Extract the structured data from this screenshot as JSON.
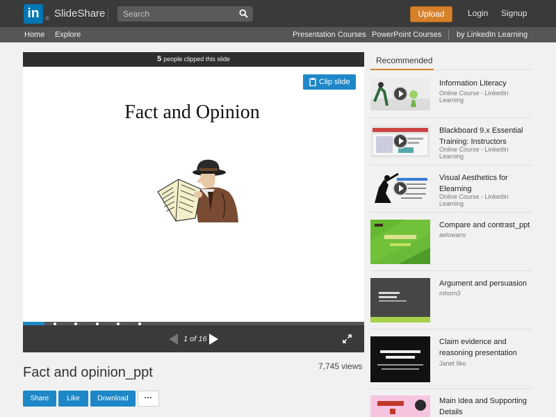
{
  "header": {
    "logo_text": "in",
    "registered_mark": "®",
    "brand": "SlideShare",
    "search_placeholder": "Search",
    "upload_label": "Upload",
    "login_label": "Login",
    "signup_label": "Signup"
  },
  "nav": {
    "left": [
      "Home",
      "Explore"
    ],
    "right": [
      "Presentation Courses",
      "PowerPoint Courses",
      "by LinkedIn Learning"
    ]
  },
  "slide_panel": {
    "clip_count": "5",
    "clip_text": "people clipped this slide",
    "clip_button": "Clip slide",
    "slide_heading": "Fact and Opinion",
    "page_indicator": "1 of 16",
    "progress": 0.0625
  },
  "deck": {
    "title": "Fact and opinion_ppt",
    "views": "7,745 views",
    "share_label": "Share",
    "like_label": "Like",
    "download_label": "Download",
    "more_label": "···"
  },
  "sidebar": {
    "tab_label": "Recommended",
    "items": [
      {
        "title": "Information Literacy",
        "subtitle": "Online Course - LinkedIn Learning"
      },
      {
        "title": "Blackboard 9.x Essential Training: Instructors",
        "subtitle": "Online Course - LinkedIn Learning"
      },
      {
        "title": "Visual Aesthetics for Elearning",
        "subtitle": "Online Course - LinkedIn Learning"
      },
      {
        "title": "Compare and contrast_ppt",
        "subtitle": "aelowans"
      },
      {
        "title": "Argument and persuasion",
        "subtitle": "mhorn3"
      },
      {
        "title": "Claim evidence and reasoning presentation",
        "subtitle": "Janet Ilko"
      },
      {
        "title": "Main Idea and Supporting Details",
        "subtitle": ""
      }
    ]
  },
  "colors": {
    "accent_blue": "#1e87c7",
    "upload_orange": "#d7812a",
    "topbar": "#3a3a3a"
  }
}
